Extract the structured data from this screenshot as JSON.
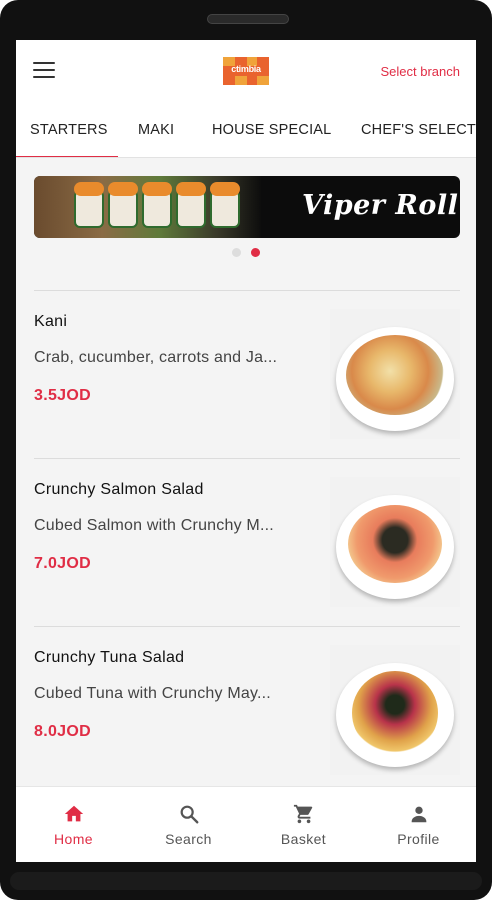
{
  "header": {
    "logo_text": "ctimbia",
    "select_branch": "Select branch"
  },
  "tabs": [
    {
      "label": "STARTERS",
      "active": true
    },
    {
      "label": "MAKI",
      "active": false
    },
    {
      "label": "HOUSE SPECIAL",
      "active": false
    },
    {
      "label": "CHEF'S SELECT",
      "active": false
    }
  ],
  "banner": {
    "title": "Viper Roll",
    "current_slide": 2,
    "slide_count": 2
  },
  "menu_items": [
    {
      "title": "Kani",
      "description": "Crab, cucumber, carrots and Ja...",
      "price": "3.5JOD"
    },
    {
      "title": "Crunchy Salmon Salad",
      "description": "Cubed Salmon with Crunchy M...",
      "price": "7.0JOD"
    },
    {
      "title": "Crunchy Tuna Salad",
      "description": "Cubed Tuna with Crunchy May...",
      "price": "8.0JOD"
    }
  ],
  "bottom_nav": [
    {
      "label": "Home",
      "icon": "home-icon",
      "active": true
    },
    {
      "label": "Search",
      "icon": "search-icon",
      "active": false
    },
    {
      "label": "Basket",
      "icon": "cart-icon",
      "active": false
    },
    {
      "label": "Profile",
      "icon": "person-icon",
      "active": false
    }
  ],
  "colors": {
    "accent": "#e02d45",
    "inactive_nav": "#555555",
    "screen_bg": "#f4f4f4"
  }
}
